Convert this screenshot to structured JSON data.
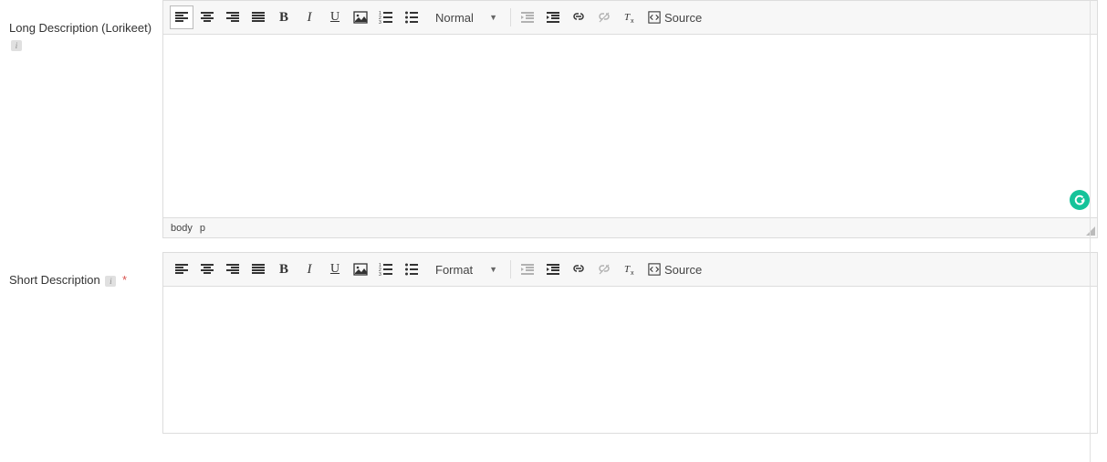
{
  "fields": {
    "longDesc": {
      "label": "Long Description (Lorikeet)",
      "toolbar": {
        "format_label": "Normal",
        "source_label": "Source"
      },
      "status_path": [
        "body",
        "p"
      ]
    },
    "shortDesc": {
      "label": "Short Description",
      "required_mark": "*",
      "toolbar": {
        "format_label": "Format",
        "source_label": "Source"
      }
    }
  },
  "icons": {
    "align_left": "align-left-icon",
    "align_center": "align-center-icon",
    "align_right": "align-right-icon",
    "justify": "justify-icon",
    "bold": "B",
    "italic": "I",
    "underline": "U",
    "image": "image-icon",
    "ol": "numbered-list-icon",
    "ul": "bulleted-list-icon",
    "outdent": "outdent-icon",
    "indent": "indent-icon",
    "link": "link-icon",
    "unlink": "unlink-icon",
    "clear": "remove-format-icon",
    "source": "source-icon"
  }
}
